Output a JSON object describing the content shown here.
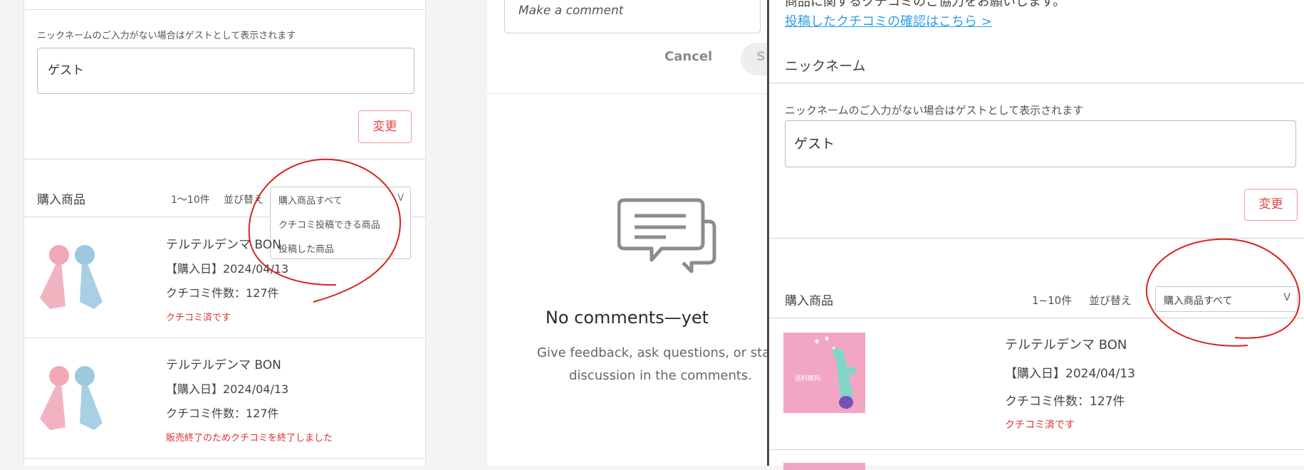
{
  "left": {
    "nickname_hint": "ニックネームのご入力がない場合はゲストとして表示されます",
    "nickname_value": "ゲスト",
    "change_button": "変更",
    "section_title": "購入商品",
    "count": "1〜10件",
    "sort_label": "並び替え",
    "dropdown_options": [
      "購入商品すべて",
      "クチコミ投稿できる商品",
      "投稿した商品"
    ],
    "products": [
      {
        "name": "テルテルデンマ BON",
        "date": "【購入日】2024/04/13",
        "reviews": "クチコミ件数：127件",
        "status": "クチコミ済です"
      },
      {
        "name": "テルテルデンマ BON",
        "date": "【購入日】2024/04/13",
        "reviews": "クチコミ件数：127件",
        "status": "販売終了のためクチコミを終了しました"
      }
    ]
  },
  "middle": {
    "comment_placeholder": "Make a comment",
    "cancel": "Cancel",
    "submit": "S",
    "empty_title": "No comments—yet",
    "empty_desc_1": "Give feedback, ask questions, or star",
    "empty_desc_2": "discussion in the comments."
  },
  "right": {
    "header_text": "商品に関するクチコミのご協力をお願いします。",
    "review_link": "投稿したクチコミの確認はこちら >",
    "nickname_label": "ニックネーム",
    "nickname_hint": "ニックネームのご入力がない場合はゲストとして表示されます",
    "nickname_value": "ゲスト",
    "change_button": "変更",
    "section_title": "購入商品",
    "count": "1~10件",
    "sort_label": "並び替え",
    "sort_value": "購入商品すべて",
    "product": {
      "name": "テルテルデンマ BON",
      "date": "【購入日】2024/04/13",
      "reviews": "クチコミ件数：127件",
      "status": "クチコミ済です",
      "badge": "送料無料"
    }
  },
  "colors": {
    "accent_red": "#e64545",
    "link_blue": "#2f9ee6",
    "annotation_red": "#d9231a"
  },
  "icons": [
    "chevron-down-icon",
    "comment-bubbles-icon"
  ]
}
